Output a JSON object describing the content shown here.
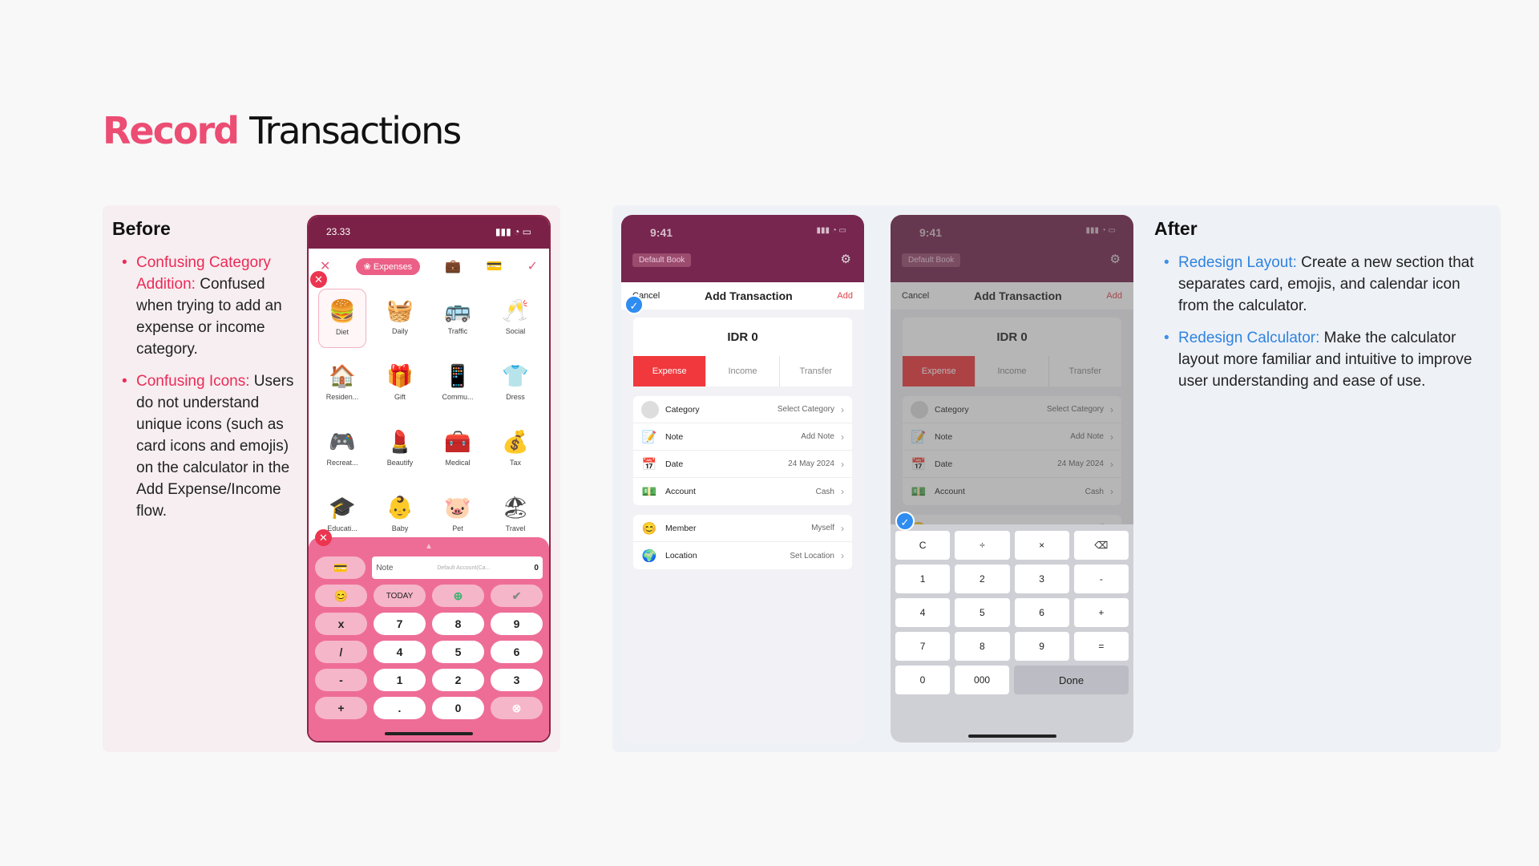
{
  "title": {
    "highlight": "Record",
    "rest": "Transactions"
  },
  "before": {
    "heading": "Before",
    "points": [
      {
        "lead": "Confusing Category Addition:",
        "text": " Confused when trying to add an expense or income category."
      },
      {
        "lead": "Confusing Icons:",
        "text": " Users do not understand unique icons (such as card icons and emojis) on the calculator in the Add Expense/Income flow."
      }
    ],
    "phone": {
      "time": "23.33",
      "tab": "Expenses",
      "categories": [
        {
          "icon": "🍔",
          "label": "Diet"
        },
        {
          "icon": "🧺",
          "label": "Daily"
        },
        {
          "icon": "🚌",
          "label": "Traffic"
        },
        {
          "icon": "🥂",
          "label": "Social"
        },
        {
          "icon": "🏠",
          "label": "Residen..."
        },
        {
          "icon": "🎁",
          "label": "Gift"
        },
        {
          "icon": "📱",
          "label": "Commu..."
        },
        {
          "icon": "👕",
          "label": "Dress"
        },
        {
          "icon": "🎮",
          "label": "Recreat..."
        },
        {
          "icon": "💄",
          "label": "Beautify"
        },
        {
          "icon": "🧰",
          "label": "Medical"
        },
        {
          "icon": "💰",
          "label": "Tax"
        },
        {
          "icon": "🎓",
          "label": "Educati..."
        },
        {
          "icon": "👶",
          "label": "Baby"
        },
        {
          "icon": "🐷",
          "label": "Pet"
        },
        {
          "icon": "🏖",
          "label": "Travel"
        }
      ],
      "note": "Note",
      "account": "Default Account(Ca...",
      "amount": "0",
      "today": "TODAY",
      "keys": [
        [
          "x",
          "7",
          "8",
          "9"
        ],
        [
          "/",
          "4",
          "5",
          "6"
        ],
        [
          "-",
          "1",
          "2",
          "3"
        ],
        [
          "+",
          ".",
          "0",
          "⊗"
        ]
      ]
    }
  },
  "after": {
    "heading": "After",
    "points": [
      {
        "lead": "Redesign Layout:",
        "text": " Create a new section that separates card, emojis, and calendar icon from the calculator."
      },
      {
        "lead": "Redesign Calculator:",
        "text": " Make the calculator layout more familiar and intuitive to improve user understanding and ease of use."
      }
    ],
    "phone": {
      "time": "9:41",
      "book": "Default Book",
      "cancel": "Cancel",
      "title": "Add Transaction",
      "add": "Add",
      "amount": "IDR 0",
      "tabs": [
        "Expense",
        "Income",
        "Transfer"
      ],
      "rows": [
        {
          "icon": "⚪",
          "label": "Category",
          "value": "Select Category"
        },
        {
          "icon": "📝",
          "label": "Note",
          "value": "Add Note"
        },
        {
          "icon": "📅",
          "label": "Date",
          "value": "24 May 2024"
        },
        {
          "icon": "💵",
          "label": "Account",
          "value": "Cash"
        }
      ],
      "rows2": [
        {
          "icon": "😊",
          "label": "Member",
          "value": "Myself"
        },
        {
          "icon": "🌍",
          "label": "Location",
          "value": "Set Location"
        }
      ],
      "calc": [
        [
          "C",
          "÷",
          "×",
          "⌫"
        ],
        [
          "1",
          "2",
          "3",
          "-"
        ],
        [
          "4",
          "5",
          "6",
          "+"
        ],
        [
          "7",
          "8",
          "9",
          "="
        ],
        [
          "0",
          "000",
          "Done"
        ]
      ]
    }
  }
}
